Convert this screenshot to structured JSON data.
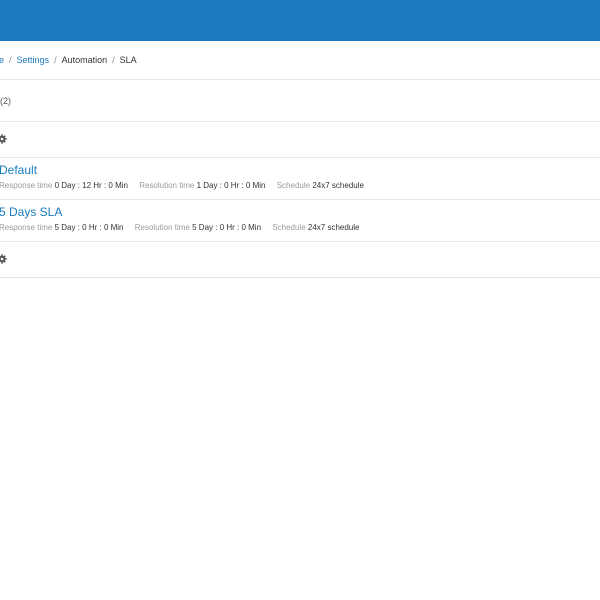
{
  "breadcrumb": {
    "items": [
      {
        "label": "e",
        "link": true
      },
      {
        "label": "Settings",
        "link": true
      },
      {
        "label": "Automation",
        "link": false
      },
      {
        "label": "SLA",
        "link": false
      }
    ],
    "separator": "/"
  },
  "list": {
    "count_text": "(2)"
  },
  "icons": {
    "gear": "gear-icon"
  },
  "policies": [
    {
      "title": "Default",
      "response_label": "Response time",
      "response_value": "0 Day : 12 Hr : 0 Min",
      "resolution_label": "Resolution time",
      "resolution_value": "1 Day : 0 Hr : 0 Min",
      "schedule_label": "Schedule",
      "schedule_value": "24x7 schedule"
    },
    {
      "title": "5 Days SLA",
      "response_label": "Response time",
      "response_value": "5 Day : 0 Hr : 0 Min",
      "resolution_label": "Resolution time",
      "resolution_value": "5 Day : 0 Hr : 0 Min",
      "schedule_label": "Schedule",
      "schedule_value": "24x7 schedule"
    }
  ],
  "colors": {
    "header": "#1a7bbf",
    "link": "#1a7bbf"
  }
}
